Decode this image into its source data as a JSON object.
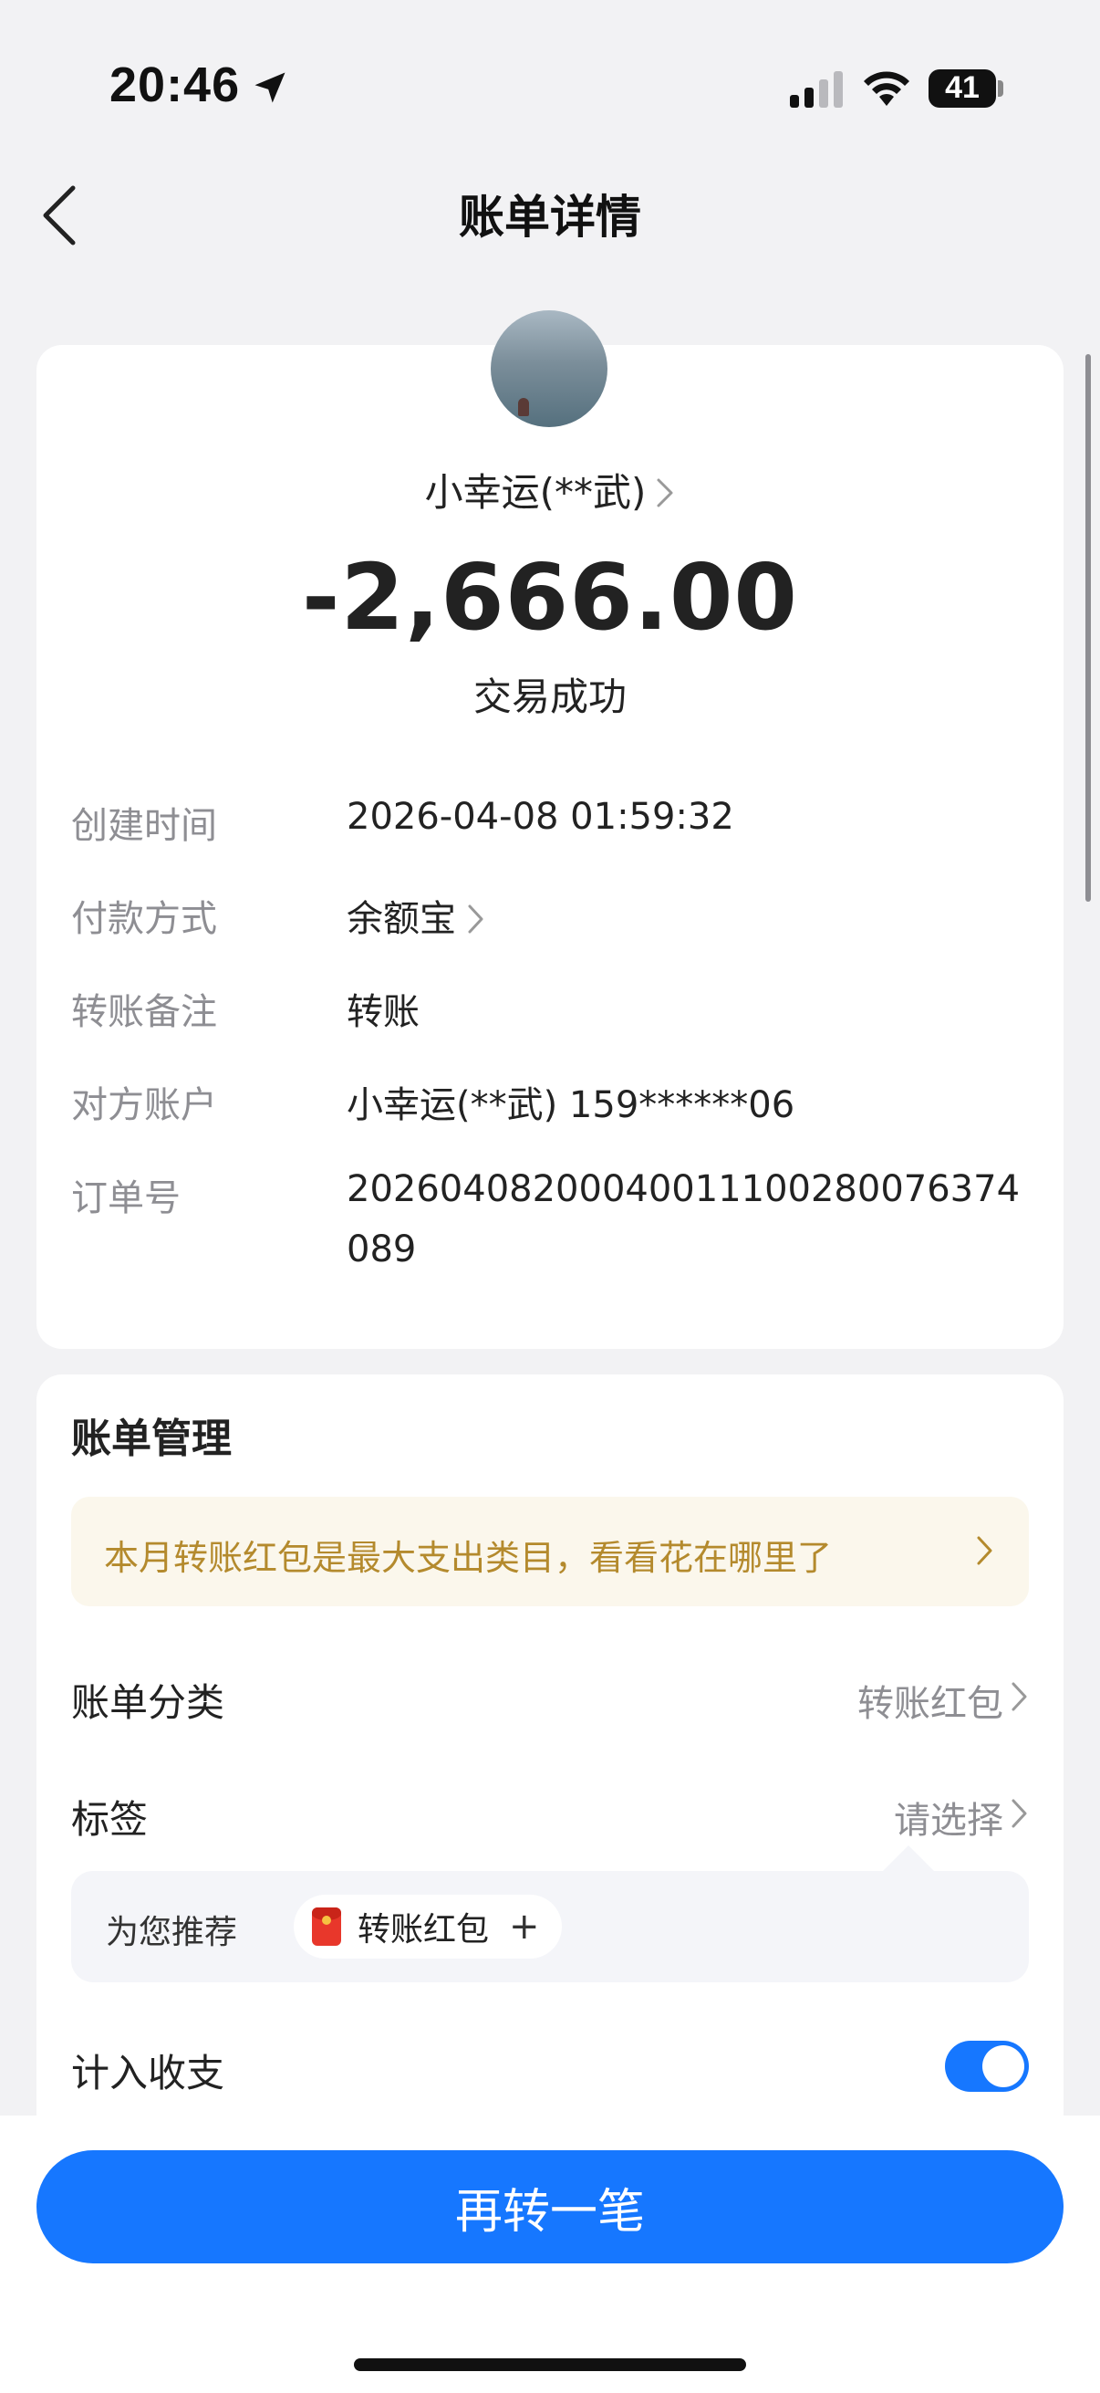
{
  "status_bar": {
    "time": "20:46",
    "battery": "41",
    "icons": [
      "location-arrow-icon",
      "cellular-signal-icon",
      "wifi-icon",
      "battery-icon"
    ]
  },
  "nav": {
    "title": "账单详情",
    "back_icon": "chevron-left-icon"
  },
  "transaction": {
    "counterparty": "小幸运(**武)",
    "amount": "-2,666.00",
    "status": "交易成功",
    "details": [
      {
        "label": "创建时间",
        "value": "2026-04-08 01:59:32"
      },
      {
        "label": "付款方式",
        "value": "余额宝"
      },
      {
        "label": "转账备注",
        "value": "转账"
      },
      {
        "label": "对方账户",
        "value": "小幸运(**武) 159******06"
      },
      {
        "label": "订单号",
        "value": "20260408200040011100280076374089"
      }
    ]
  },
  "management": {
    "title": "账单管理",
    "tip": "本月转账红包是最大支出类目，看看花在哪里了",
    "category_label": "账单分类",
    "category_value": "转账红包",
    "tag_label": "标签",
    "tag_value": "请选择",
    "recommend_label": "为您推荐",
    "recommend_tag": "转账红包",
    "include_label": "计入收支",
    "include_enabled": true
  },
  "primary_action": "再转一笔",
  "colors": {
    "accent": "#1677ff",
    "tip_text": "#b48a2d",
    "tip_bg": "#fbf7ec"
  }
}
